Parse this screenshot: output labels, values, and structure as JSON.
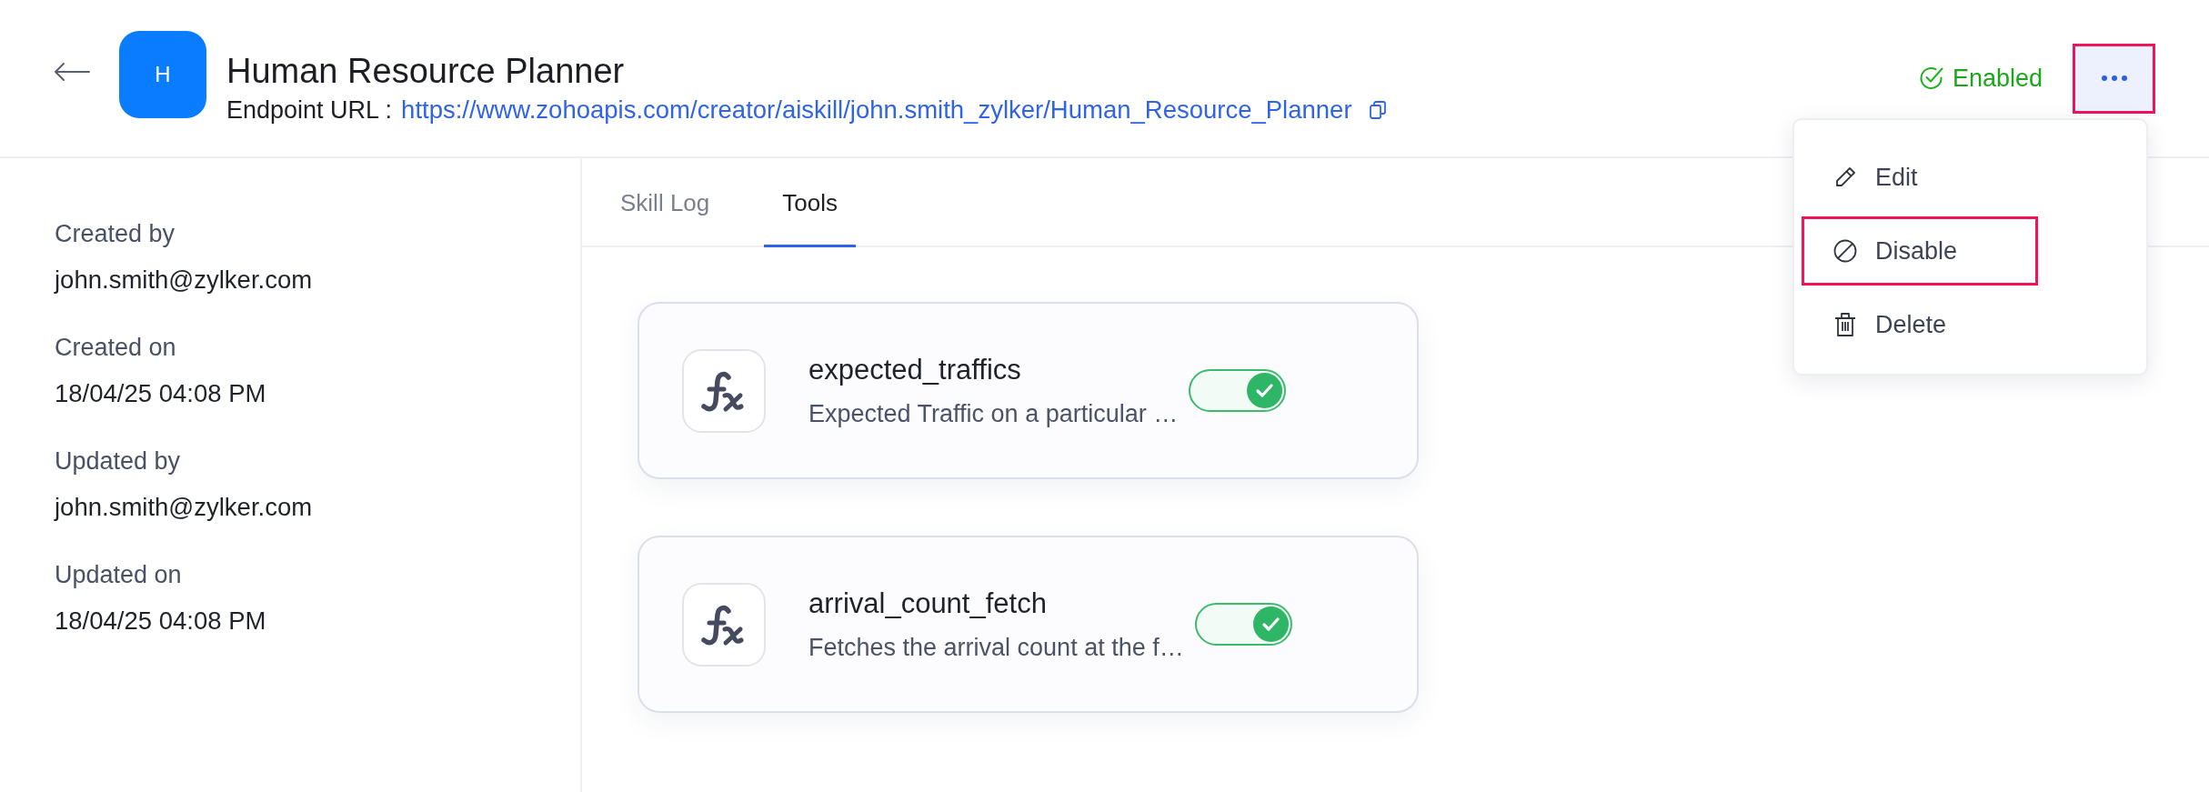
{
  "header": {
    "title": "Human Resource Planner",
    "avatar_letter": "H",
    "endpoint_label": "Endpoint URL :",
    "endpoint_url": "https://www.zohoapis.com/creator/aiskill/john.smith_zylker/Human_Resource_Planner",
    "status": {
      "label": "Enabled",
      "enabled": true
    },
    "more_button": {
      "highlighted": true
    }
  },
  "menu": {
    "open": true,
    "items": [
      {
        "kind": "edit",
        "label": "Edit",
        "highlighted": false
      },
      {
        "kind": "disable",
        "label": "Disable",
        "highlighted": true
      },
      {
        "kind": "delete",
        "label": "Delete",
        "highlighted": false
      }
    ]
  },
  "details": [
    {
      "label": "Created by",
      "value": "john.smith@zylker.com"
    },
    {
      "label": "Created on",
      "value": "18/04/25 04:08 PM"
    },
    {
      "label": "Updated by",
      "value": "john.smith@zylker.com"
    },
    {
      "label": "Updated on",
      "value": "18/04/25 04:08 PM"
    }
  ],
  "tabs": [
    {
      "label": "Skill Log",
      "selected": false
    },
    {
      "label": "Tools",
      "selected": true
    }
  ],
  "tools": [
    {
      "name": "expected_traffics",
      "description": "Expected Traffic on a particular …",
      "on": true
    },
    {
      "name": "arrival_count_fetch",
      "description": "Fetches the arrival count at the f…",
      "on": true
    }
  ]
}
